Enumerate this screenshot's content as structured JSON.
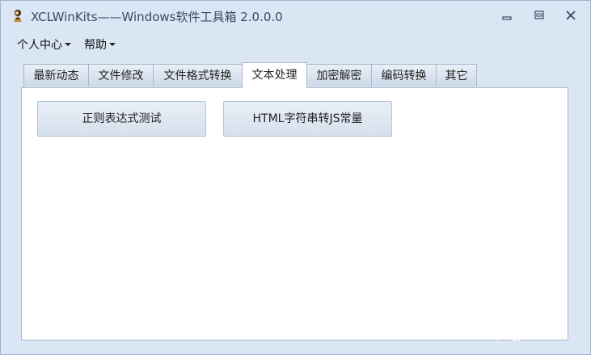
{
  "window": {
    "title": "XCLWinKits——Windows软件工具箱 2.0.0.0"
  },
  "menubar": {
    "items": [
      {
        "label": "个人中心"
      },
      {
        "label": "帮助"
      }
    ]
  },
  "tabs": [
    {
      "label": "最新动态",
      "active": false
    },
    {
      "label": "文件修改",
      "active": false
    },
    {
      "label": "文件格式转换",
      "active": false
    },
    {
      "label": "文本处理",
      "active": true
    },
    {
      "label": "加密解密",
      "active": false
    },
    {
      "label": "编码转换",
      "active": false
    },
    {
      "label": "其它",
      "active": false
    }
  ],
  "panel": {
    "buttons": [
      {
        "label": "正则表达式测试"
      },
      {
        "label": "HTML字符串转JS常量"
      }
    ]
  },
  "watermark": {
    "text": "知乎 @xu xu"
  },
  "colors": {
    "window_bg": "#dbe6f4",
    "panel_bg": "#ffffff",
    "border": "#a9b8ca",
    "button_bg": "#dde6f1"
  }
}
